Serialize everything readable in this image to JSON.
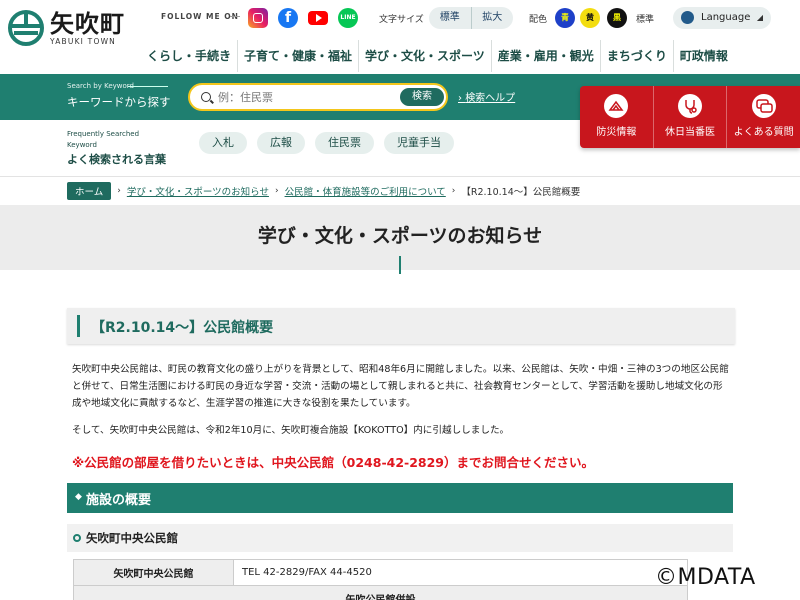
{
  "brand": {
    "name_jp": "矢吹町",
    "name_en": "YABUKI TOWN",
    "color": "#1f7f70"
  },
  "header": {
    "follow_me": "FOLLOW ME ON",
    "sns": [
      "instagram-icon",
      "facebook-icon",
      "youtube-icon",
      "line-icon"
    ],
    "font_size_label": "文字サイズ",
    "font_size_options": [
      "標準",
      "拡大"
    ],
    "color_label": "配色",
    "color_options": [
      "青",
      "黄",
      "黒"
    ],
    "color_standard": "標準",
    "language": "Language"
  },
  "nav": [
    "くらし・手続き",
    "子育て・健康・福祉",
    "学び・文化・スポーツ",
    "産業・雇用・観光",
    "まちづくり",
    "町政情報"
  ],
  "search": {
    "label_en": "Search by Keyword",
    "label_jp": "キーワードから探す",
    "placeholder": "例：住民票",
    "button": "検索",
    "help": "検索ヘルプ"
  },
  "quick_links": [
    {
      "label": "防災情報",
      "icon": "disaster-icon"
    },
    {
      "label": "休日当番医",
      "icon": "stethoscope-icon"
    },
    {
      "label": "よくある質問",
      "icon": "faq-icon"
    }
  ],
  "frequent": {
    "label_en": "Frequently Searched Keyword",
    "label_jp": "よく検索される言葉",
    "tags": [
      "入札",
      "広報",
      "住民票",
      "児童手当"
    ]
  },
  "breadcrumb": {
    "home": "ホーム",
    "links": [
      "学び・文化・スポーツのお知らせ",
      "公民館・体育施設等のご利用について"
    ],
    "current": "【R2.10.14～】公民館概要"
  },
  "page_title": "学び・文化・スポーツのお知らせ",
  "article": {
    "heading": "【R2.10.14～】公民館概要",
    "para1": "矢吹町中央公民館は、町民の教育文化の盛り上がりを背景として、昭和48年6月に開館しました。以来、公民館は、矢吹・中畑・三神の3つの地区公民館と併せて、日常生活圏における町民の身近な学習・交流・活動の場として親しまれると共に、社会教育センターとして、学習活動を援助し地域文化の形成や地域文化に貢献するなど、生涯学習の推進に大きな役割を果たしています。",
    "para2": "そして、矢吹町中央公民館は、令和2年10月に、矢吹町複合施設【KOKOTTO】内に引越ししました。",
    "notice": "※公民館の部屋を借りたいときは、中央公民館（0248-42-2829）までお問合せください。",
    "section": "施設の概要",
    "subsection": "矢吹町中央公民館",
    "table": [
      {
        "label": "矢吹町中央公民館",
        "value": "TEL 42-2829/FAX 44-4520"
      },
      {
        "label": "矢吹公民館併設",
        "value": ""
      }
    ]
  },
  "watermark": "©MDATA"
}
